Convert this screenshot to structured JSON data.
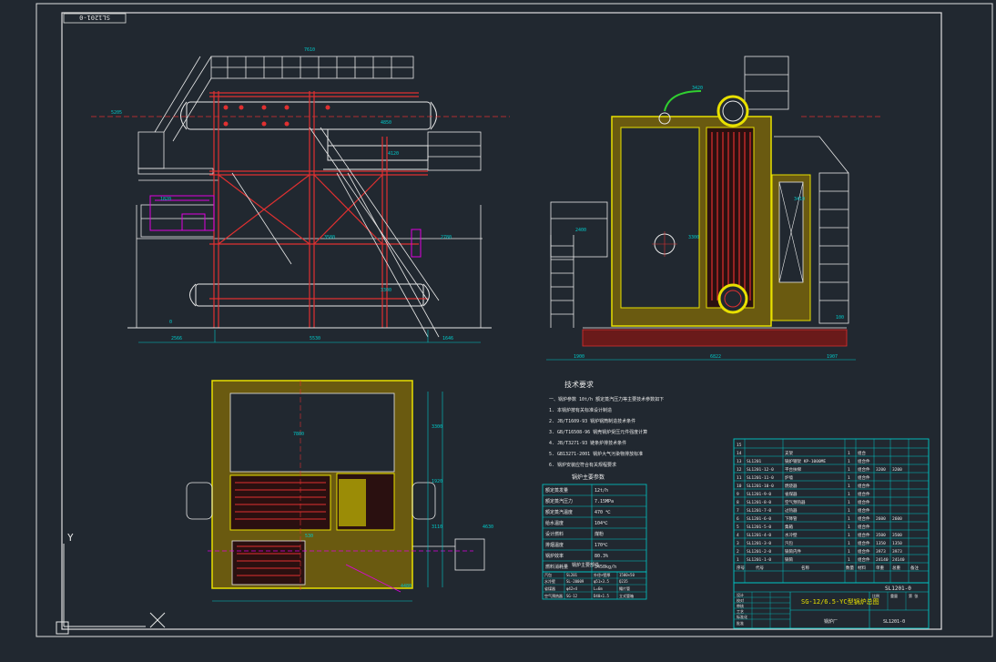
{
  "drawing": {
    "stamp_top": "SL1201-0",
    "drawing_no": "SL1201-0",
    "title": "SG-12/6.5-YC型锅炉总图"
  },
  "colors": {
    "background": "#212830",
    "frame": "#e0e0e0",
    "cyan": "#00c8c8",
    "yellow": "#e8e000",
    "red": "#e03030",
    "magenta": "#e000e0",
    "white": "#e8e8e8",
    "green": "#30d030"
  },
  "dims": {
    "front": [
      "7610",
      "5205",
      "4850",
      "4120",
      "3580",
      "2780",
      "1820",
      "0",
      "3300",
      "2566",
      "5530",
      "1646"
    ],
    "side": [
      "3420",
      "3410",
      "2400",
      "3300",
      "100",
      "1900",
      "6822",
      "1907"
    ],
    "plan": [
      "7800",
      "3300",
      "1920",
      "3110",
      "4480",
      "4630",
      "530"
    ]
  },
  "notes": {
    "heading": "技术要求",
    "lines": [
      "一、锅炉参数 10t/h 额定蒸汽压力等主要技术参数如下",
      "1. 本锅炉按有关标准设计制造",
      "2. JB/T1609-93 锅炉锅筒制造技术条件",
      "3. GB/T16508-96 锅壳锅炉受压元件强度计算",
      "4. JB/T3271-93 链条炉排技术条件",
      "5. GB13271-2001 锅炉大气污染物排放标准",
      "6. 锅炉安装应符合有关规程要求"
    ]
  },
  "params": {
    "heading": "锅炉主要参数",
    "rows": [
      [
        "额定蒸发量",
        "12t/h"
      ],
      [
        "额定蒸汽压力",
        "7.15MPa"
      ],
      [
        "额定蒸汽温度",
        "470 ℃"
      ],
      [
        "给水温度",
        "104℃"
      ],
      [
        "设计燃料",
        "煤粉"
      ],
      [
        "排烟温度",
        "170℃"
      ],
      [
        "锅炉效率",
        "80.3%"
      ],
      [
        "燃料消耗量",
        "3450kg/h"
      ]
    ]
  },
  "components": {
    "heading": "锅炉主要部件",
    "rows": [
      [
        "汽包",
        "SL201",
        "外径×壁厚",
        "1500×50"
      ],
      [
        "水冷壁",
        "SL-20009",
        "φ51×3.5",
        "Q235"
      ],
      [
        "省煤器",
        "φ42×4",
        "L=6m",
        "鳍片管"
      ],
      [
        "空气预热器",
        "SG-12",
        "D40×1.5",
        "立式管箱"
      ]
    ]
  },
  "bom": {
    "header": [
      "序号",
      "代号",
      "名称",
      "数量",
      "材料",
      "单重",
      "总重",
      "备注"
    ],
    "rows": [
      [
        "15",
        "",
        "",
        "",
        "",
        "",
        ""
      ],
      [
        "14",
        "",
        "支架",
        "1",
        "组合",
        "",
        ""
      ],
      [
        "13",
        "SL1201",
        "锅炉钢架 KP-1000ME",
        "1",
        "组合件",
        "",
        ""
      ],
      [
        "12",
        "SL1201-12-0",
        "平台扶梯",
        "1",
        "组合件",
        "3200",
        "3200"
      ],
      [
        "11",
        "SL1201-11-0",
        "炉墙",
        "1",
        "组合件",
        "",
        ""
      ],
      [
        "10",
        "SL1201-10-0",
        "燃烧器",
        "1",
        "组合件",
        "",
        ""
      ],
      [
        "9",
        "SL1201-9-0",
        "省煤器",
        "1",
        "组合件",
        "",
        ""
      ],
      [
        "8",
        "SL1201-8-0",
        "空气预热器",
        "1",
        "组合件",
        "",
        ""
      ],
      [
        "7",
        "SL1201-7-0",
        "过热器",
        "1",
        "组合件",
        "",
        ""
      ],
      [
        "6",
        "SL1201-6-0",
        "下降管",
        "1",
        "组合件",
        "2600",
        "2600"
      ],
      [
        "5",
        "SL1201-5-0",
        "集箱",
        "1",
        "组合件",
        "",
        ""
      ],
      [
        "4",
        "SL1201-4-0",
        "水冷壁",
        "1",
        "组合件",
        "3500",
        "3500"
      ],
      [
        "3",
        "SL1201-3-0",
        "汽包",
        "1",
        "组合件",
        "1350",
        "1350"
      ],
      [
        "2",
        "SL1201-2-0",
        "锅筒内件",
        "1",
        "组合件",
        "3973",
        "3973"
      ],
      [
        "1",
        "SL1201-1-0",
        "锅筒",
        "1",
        "组合件",
        "24140",
        "24140"
      ]
    ]
  },
  "titleblock": {
    "labels": [
      "设计",
      "校对",
      "审核",
      "工艺",
      "标准化",
      "批准"
    ],
    "scale_label": "比例",
    "weight_label": "重量",
    "sheet_label": "第 张",
    "company": "锅炉厂"
  },
  "ucs": {
    "y_label": "Y"
  }
}
